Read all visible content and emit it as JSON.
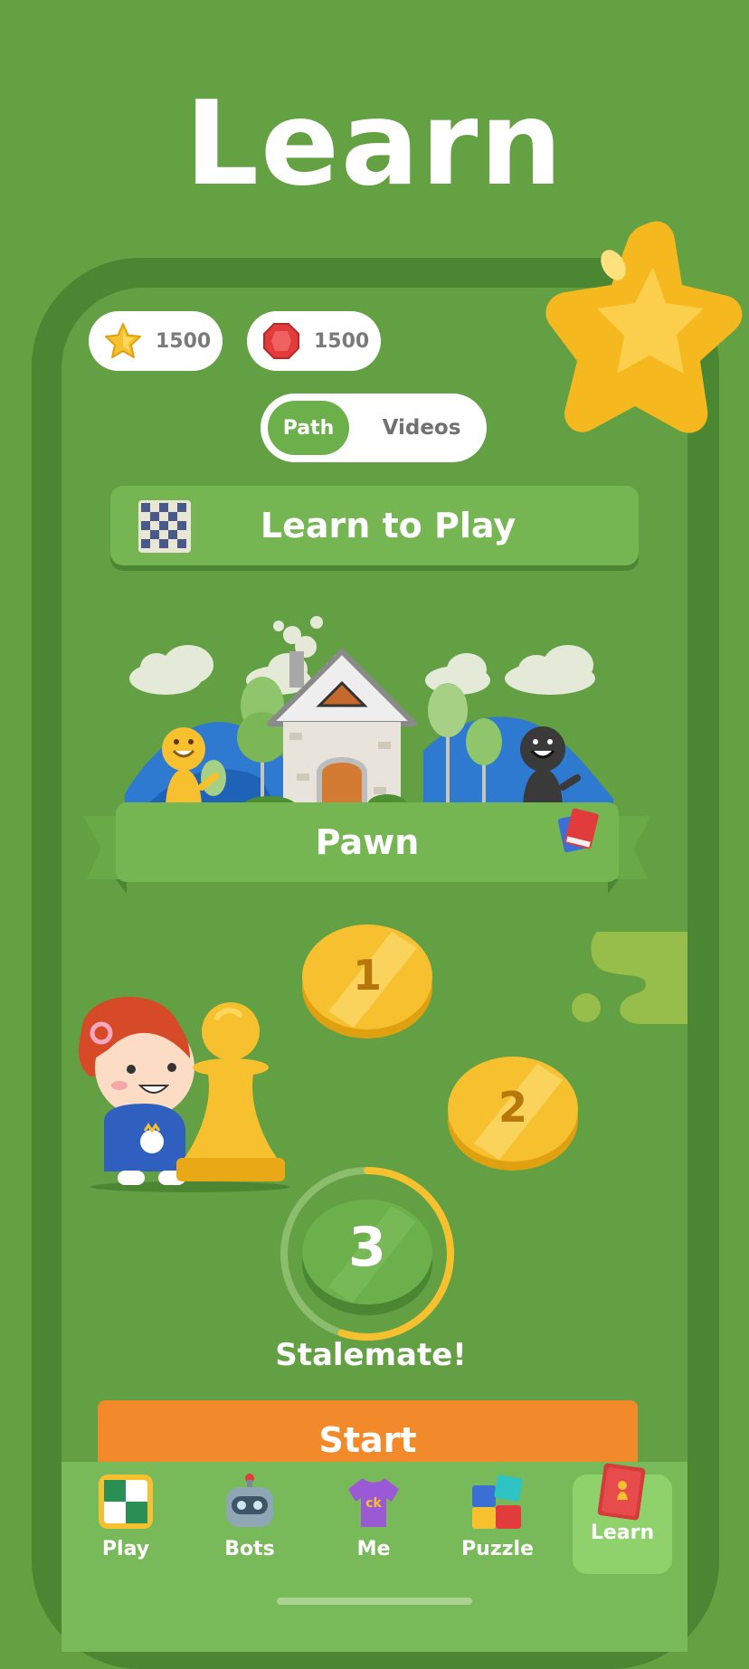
{
  "headline": "Learn",
  "currencies": [
    {
      "icon": "star-coin-icon",
      "value": "1500"
    },
    {
      "icon": "gem-icon",
      "value": "1500"
    }
  ],
  "tabs": {
    "path": "Path",
    "videos": "Videos",
    "selected": "Path"
  },
  "course": {
    "title": "Learn to Play",
    "icon": "chessboard-icon"
  },
  "unit": {
    "title": "Pawn",
    "icon": "book-icon"
  },
  "lessons": [
    {
      "number": "1",
      "state": "completed"
    },
    {
      "number": "2",
      "state": "completed"
    },
    {
      "number": "3",
      "state": "current",
      "progress": 0.55
    }
  ],
  "current_lesson": {
    "title": "Stalemate!",
    "button": "Start"
  },
  "bottom_nav": [
    {
      "label": "Play",
      "icon": "play-board-icon",
      "active": false
    },
    {
      "label": "Bots",
      "icon": "robot-icon",
      "active": false
    },
    {
      "label": "Me",
      "icon": "tshirt-icon",
      "active": false
    },
    {
      "label": "Puzzle",
      "icon": "puzzle-icon",
      "active": false
    },
    {
      "label": "Learn",
      "icon": "learn-book-icon",
      "active": true
    }
  ],
  "colors": {
    "background": "#64a142",
    "accent": "#f28a2b",
    "gold": "#f6c02f",
    "active_tab": "#8fd26b"
  }
}
